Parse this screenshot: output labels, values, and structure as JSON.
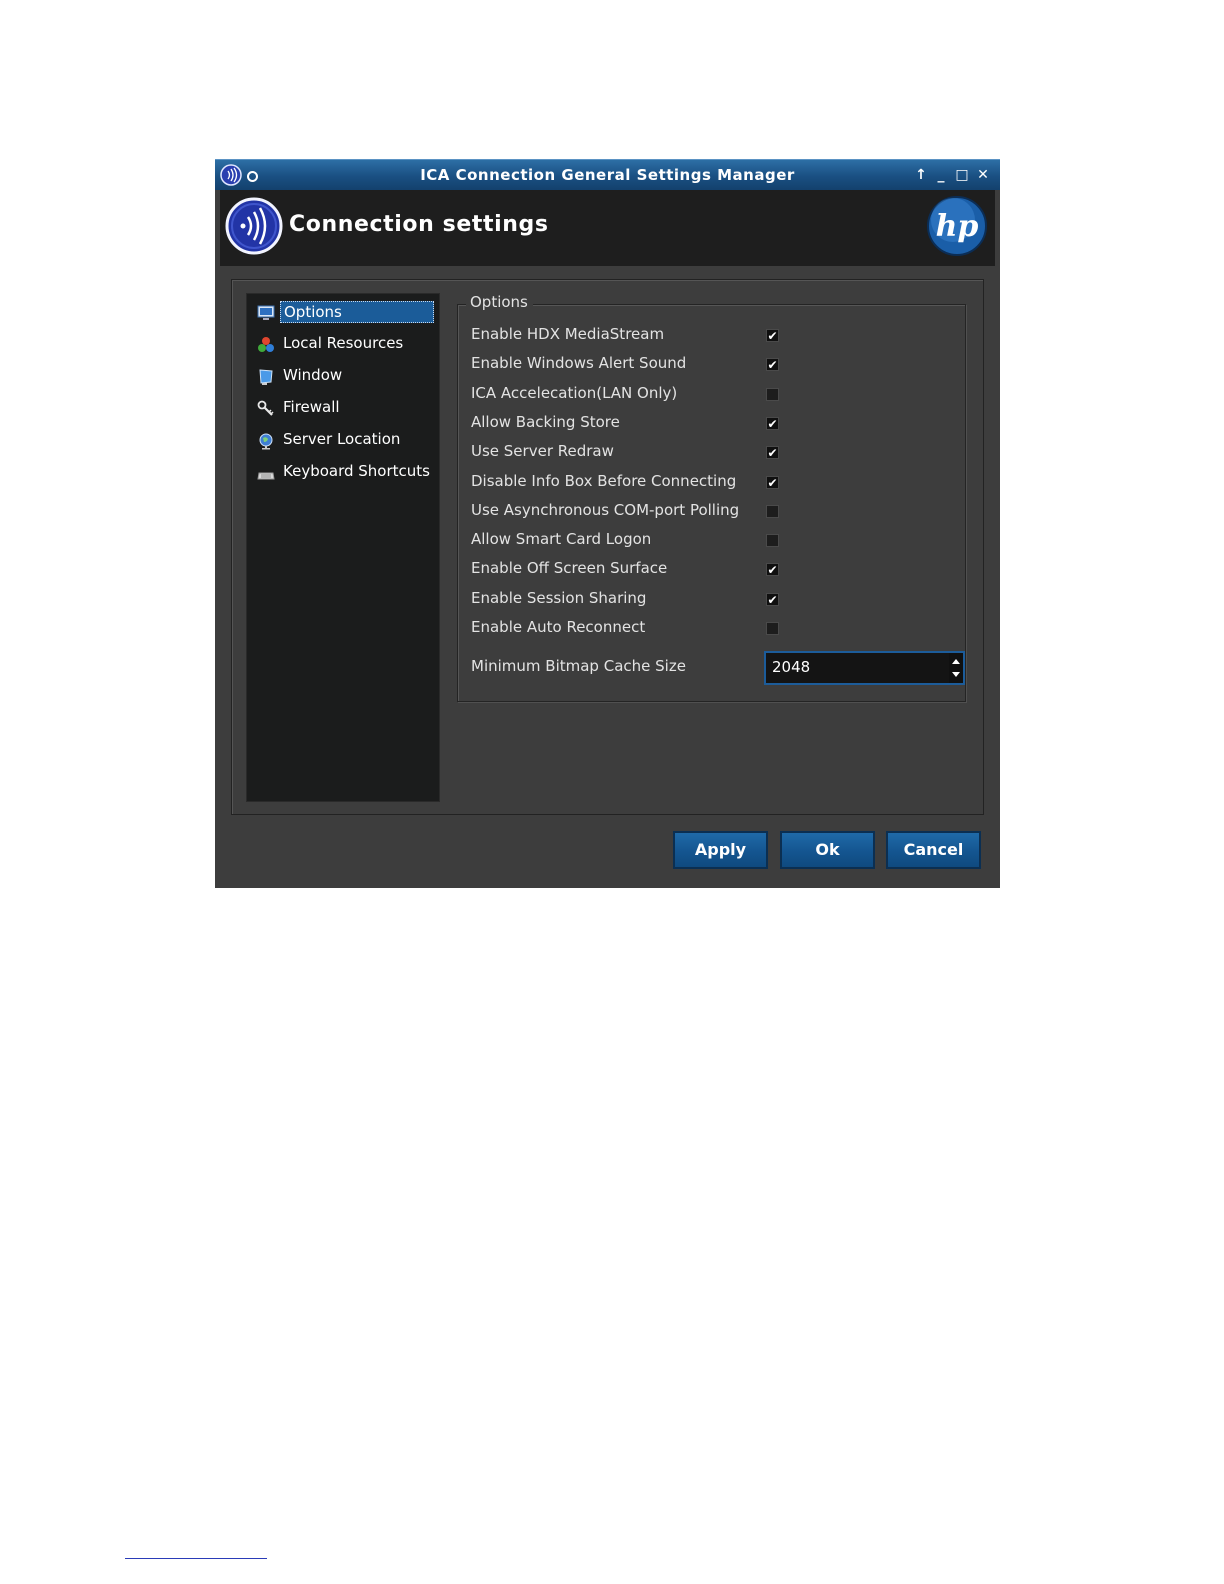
{
  "window": {
    "title": "ICA Connection General Settings Manager",
    "controls": [
      "up-arrow-icon",
      "minimize-icon",
      "maximize-icon",
      "close-icon"
    ]
  },
  "banner": {
    "heading": "Connection settings",
    "logo_icon": "citrix-receiver-icon",
    "brand_logo": "hp"
  },
  "nav": {
    "items": [
      {
        "label": "Options",
        "icon": "monitor-icon",
        "selected": true
      },
      {
        "label": "Local Resources",
        "icon": "resources-icon",
        "selected": false
      },
      {
        "label": "Window",
        "icon": "window-icon",
        "selected": false
      },
      {
        "label": "Firewall",
        "icon": "firewall-icon",
        "selected": false
      },
      {
        "label": "Server Location",
        "icon": "globe-icon",
        "selected": false
      },
      {
        "label": "Keyboard Shortcuts",
        "icon": "keyboard-icon",
        "selected": false
      }
    ]
  },
  "options": {
    "group_title": "Options",
    "items": [
      {
        "label": "Enable HDX MediaStream",
        "checked": true
      },
      {
        "label": "Enable Windows Alert Sound",
        "checked": true
      },
      {
        "label": "ICA Accelecation(LAN Only)",
        "checked": false
      },
      {
        "label": "Allow Backing Store",
        "checked": true
      },
      {
        "label": "Use Server Redraw",
        "checked": true
      },
      {
        "label": "Disable Info Box Before Connecting",
        "checked": true
      },
      {
        "label": "Use Asynchronous COM-port Polling",
        "checked": false
      },
      {
        "label": "Allow Smart Card Logon",
        "checked": false
      },
      {
        "label": "Enable Off Screen Surface",
        "checked": true
      },
      {
        "label": "Enable Session Sharing",
        "checked": true
      },
      {
        "label": "Enable Auto Reconnect",
        "checked": false
      }
    ],
    "cache": {
      "label": "Minimum Bitmap Cache Size",
      "value": "2048"
    }
  },
  "buttons": {
    "apply": "Apply",
    "ok": "Ok",
    "cancel": "Cancel"
  },
  "colors": {
    "titlebar": "#1a4f82",
    "selection": "#1b5c99",
    "button": "#145590",
    "panel": "#3d3d3d"
  }
}
